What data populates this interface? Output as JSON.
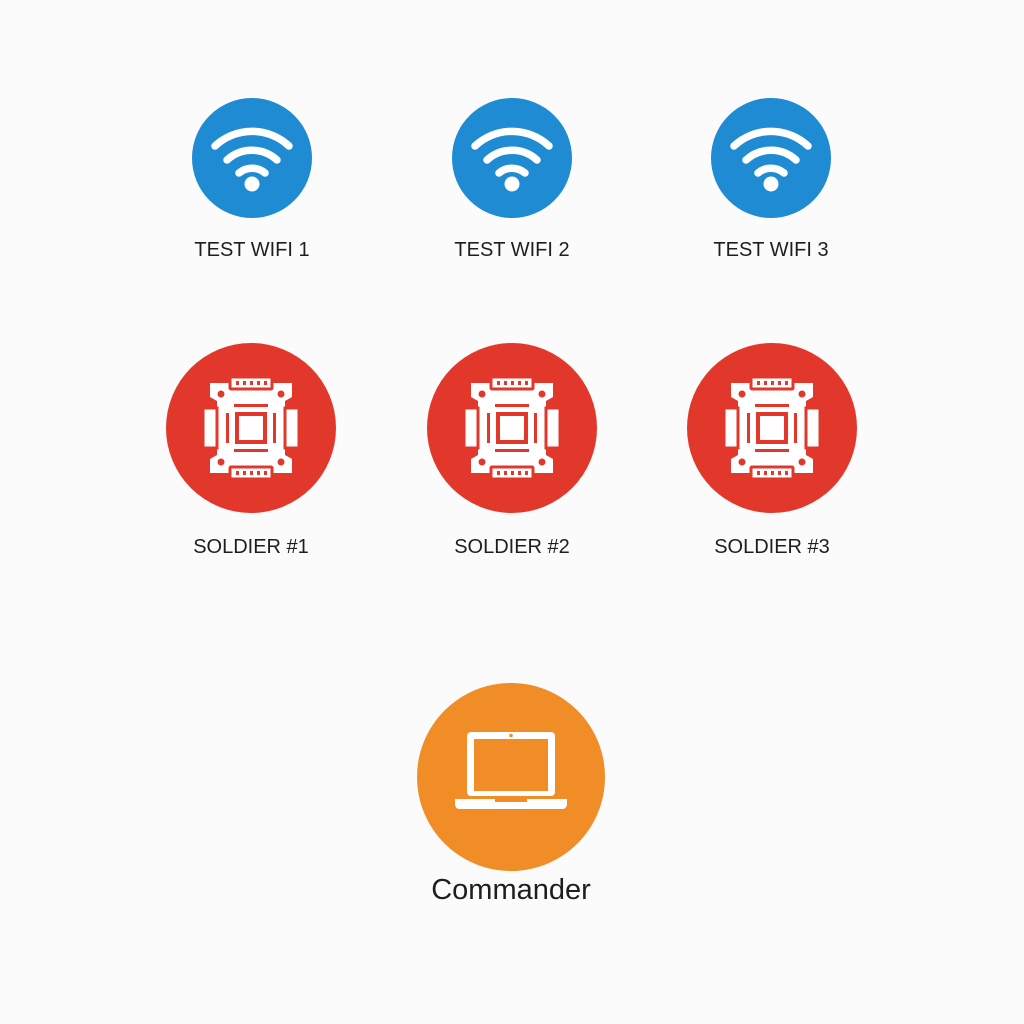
{
  "colors": {
    "wifi": "#1e8bd3",
    "soldier": "#e2382c",
    "commander": "#f18d27",
    "glyph": "#ffffff"
  },
  "wifi_nodes": [
    {
      "label": "TEST WIFI 1",
      "icon": "wifi-icon"
    },
    {
      "label": "TEST WIFI 2",
      "icon": "wifi-icon"
    },
    {
      "label": "TEST WIFI 3",
      "icon": "wifi-icon"
    }
  ],
  "soldier_nodes": [
    {
      "label": "SOLDIER #1",
      "icon": "circuit-board-icon"
    },
    {
      "label": "SOLDIER #2",
      "icon": "circuit-board-icon"
    },
    {
      "label": "SOLDIER #3",
      "icon": "circuit-board-icon"
    }
  ],
  "commander": {
    "label": "Commander",
    "icon": "laptop-icon"
  }
}
